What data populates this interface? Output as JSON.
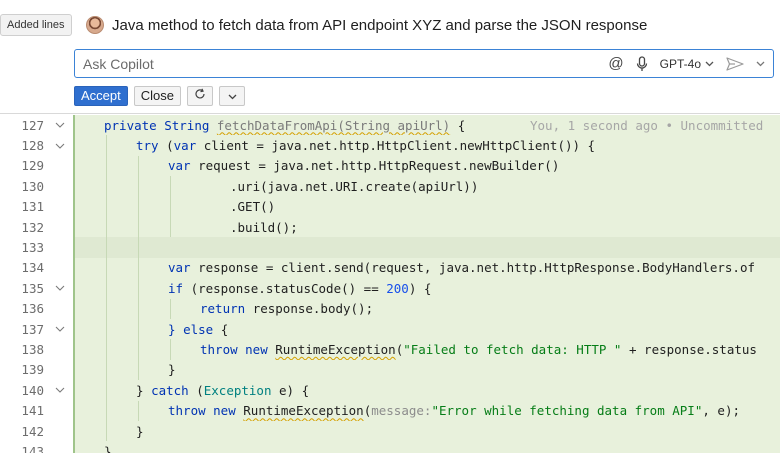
{
  "tooltip": "Added lines",
  "prompt": "Java method to fetch data from API endpoint XYZ and parse the JSON response",
  "ask": {
    "placeholder": "Ask Copilot",
    "model": "GPT-4o"
  },
  "actions": {
    "accept": "Accept",
    "close": "Close"
  },
  "editor": {
    "blame": "You, 1 second ago • Uncommitted",
    "lines": [
      {
        "n": "127",
        "fold": true
      },
      {
        "n": "128",
        "fold": true
      },
      {
        "n": "129",
        "fold": false
      },
      {
        "n": "130",
        "fold": false
      },
      {
        "n": "131",
        "fold": false
      },
      {
        "n": "132",
        "fold": false
      },
      {
        "n": "133",
        "fold": false
      },
      {
        "n": "134",
        "fold": false
      },
      {
        "n": "135",
        "fold": true
      },
      {
        "n": "136",
        "fold": false
      },
      {
        "n": "137",
        "fold": true
      },
      {
        "n": "138",
        "fold": false
      },
      {
        "n": "139",
        "fold": false
      },
      {
        "n": "140",
        "fold": true
      },
      {
        "n": "141",
        "fold": false
      },
      {
        "n": "142",
        "fold": false
      },
      {
        "n": "143",
        "fold": false
      }
    ],
    "code": {
      "l127a": "private ",
      "l127b": "String ",
      "l127c": "fetchDataFromApi(String apiUrl)",
      "l127d": " {",
      "l128a": "try ",
      "l128b": "(",
      "l128c": "var ",
      "l128d": "client = java.net.http.HttpClient.newHttpClient()) {",
      "l129a": "var ",
      "l129b": "request = java.net.http.HttpRequest.newBuilder()",
      "l130": ".uri(java.net.URI.create(apiUrl))",
      "l131": ".GET()",
      "l132": ".build();",
      "l134a": "var ",
      "l134b": "response = client.send(request, java.net.http.HttpResponse.BodyHandlers.of",
      "l135a": "if ",
      "l135b": "(response.statusCode() == ",
      "l135c": "200",
      "l135d": ") {",
      "l136a": "return ",
      "l136b": "response.body();",
      "l137a": "} ",
      "l137b": "else ",
      "l137c": "{",
      "l138a": "throw new ",
      "l138b": "RuntimeException",
      "l138c": "(",
      "l138d": "\"Failed to fetch data: HTTP \"",
      "l138e": " + response.status",
      "l139": "}",
      "l140a": "} ",
      "l140b": "catch ",
      "l140c": "(",
      "l140d": "Exception",
      "l140e": " e) {",
      "l141a": "throw new ",
      "l141b": "RuntimeException",
      "l141c": "(",
      "l141d": "message:",
      "l141e": "\"Error while fetching data from API\"",
      "l141f": ", e);",
      "l142": "}",
      "l143": "}"
    }
  },
  "colors": {
    "accent": "#2f6fcf",
    "added_bg": "#e8f1dc",
    "added_bar": "#9fc48a"
  }
}
